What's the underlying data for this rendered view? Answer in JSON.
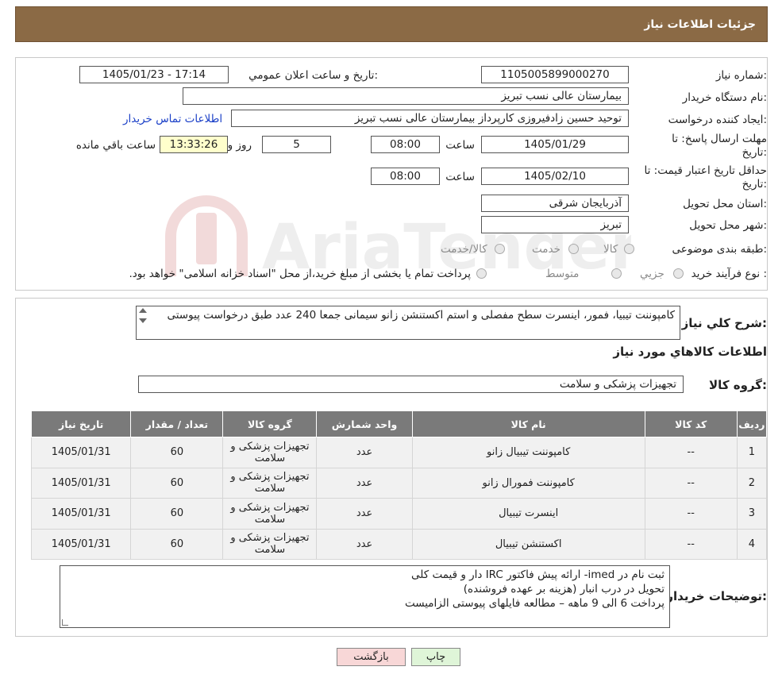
{
  "header": {
    "title": "جزئیات اطلاعات نیاز"
  },
  "form": {
    "need_number_label": "شماره نیاز:",
    "need_number": "1105005899000270",
    "announce_label": "تاریخ و ساعت اعلان عمومي:",
    "announce_value": "1405/01/23 - 17:14",
    "buyer_org_label": "نام دستگاه خريدار:",
    "buyer_org": "بیمارستان عالی نسب تبریز",
    "creator_label": "ایجاد کننده درخواست:",
    "creator": "توحید حسین زادفیروزی کارپرداز بیمارستان عالی نسب تبریز",
    "contact_link": "اطلاعات تماس خريدار",
    "deadline_label_1": "مهلت ارسال پاسخ: تا",
    "deadline_label_2": "تاريخ:",
    "deadline_date": "1405/01/29",
    "time_label": "ساعت",
    "deadline_time": "08:00",
    "days_value": "5",
    "days_label": "روز و",
    "remaining_time": "13:33:26",
    "remaining_label": "ساعت باقي مانده",
    "validity_label_1": "حداقل تاريخ اعتبار قيمت: تا",
    "validity_label_2": "تاريخ:",
    "validity_date": "1405/02/10",
    "validity_time": "08:00",
    "province_label": "استان محل تحويل:",
    "province": "آذربایجان شرقی",
    "city_label": "شهر محل تحويل:",
    "city": "تبریز",
    "category_label": "طبقه بندی موضوعی:",
    "category_options": [
      "کالا",
      "خدمت",
      "کالا/خدمت"
    ],
    "purchase_type_label": "نوع فرآيند خريد :",
    "purchase_options": [
      "جزيي",
      "متوسط"
    ],
    "purchase_note": "پرداخت تمام یا بخشی از مبلغ خرید،از محل \"اسناد خزانه اسلامی\" خواهد بود."
  },
  "description": {
    "label": "شرح كلي نياز:",
    "text": "کامپوننت تیبیا، فمور، اینسرت سطح مفصلی و استم اکستنشن زانو سیمانی جمعا 240 عدد طبق درخواست پیوستی"
  },
  "goods": {
    "section_title": "اطلاعات كالاهاي مورد نياز",
    "group_label": "گروه کالا:",
    "group_value": "تجهیزات پزشکی و سلامت",
    "columns": [
      "رديف",
      "کد کالا",
      "نام کالا",
      "واحد شمارش",
      "گروه کالا",
      "تعداد / مقدار",
      "تاریخ نیاز"
    ],
    "rows": [
      {
        "idx": "1",
        "code": "--",
        "name": "کامپوننت تیبیال زانو",
        "unit": "عدد",
        "group": "تجهیزات پزشکی و سلامت",
        "qty": "60",
        "date": "1405/01/31"
      },
      {
        "idx": "2",
        "code": "--",
        "name": "کامپوننت فمورال زانو",
        "unit": "عدد",
        "group": "تجهیزات پزشکی و سلامت",
        "qty": "60",
        "date": "1405/01/31"
      },
      {
        "idx": "3",
        "code": "--",
        "name": "اینسرت تیبیال",
        "unit": "عدد",
        "group": "تجهیزات پزشکی و سلامت",
        "qty": "60",
        "date": "1405/01/31"
      },
      {
        "idx": "4",
        "code": "--",
        "name": "اکستنشن تیبیال",
        "unit": "عدد",
        "group": "تجهیزات پزشکی و سلامت",
        "qty": "60",
        "date": "1405/01/31"
      }
    ]
  },
  "buyer_notes": {
    "label": "توضیحات خریدار:",
    "line1": "ثبت نام در imed- ارائه پیش فاکتور IRC دار و قیمت کلی",
    "line2": "تحویل در درب انبار (هزینه بر عهده فروشنده)",
    "line3": "پرداخت  6 الی 9 ماهه – مطالعه فایلهای پیوستی الزامیست"
  },
  "buttons": {
    "print": "چاپ",
    "back": "بازگشت"
  },
  "watermark": {
    "text": "AriaTender.neT"
  },
  "colors": {
    "header": "#8b6a45",
    "table_header": "#7a7a7a",
    "link": "#1a3fc7",
    "remaining_bg": "#ffffcc",
    "print_btn": "#dff5d8",
    "back_btn": "#f8d7d7"
  }
}
